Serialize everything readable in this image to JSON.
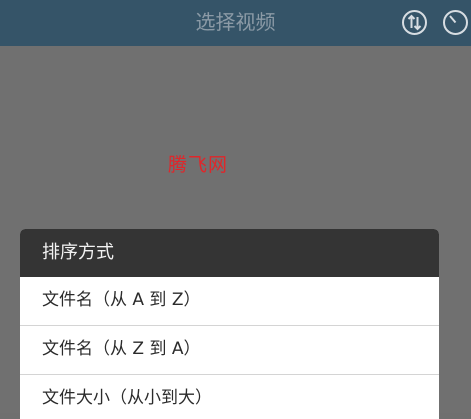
{
  "header": {
    "title": "选择视频",
    "sort_icon": "sort-arrows-icon",
    "timer_icon": "clock-icon"
  },
  "watermark": {
    "text": "腾飞网"
  },
  "sort_dialog": {
    "title": "排序方式",
    "options": [
      {
        "label": "文件名（从 A 到 Z）"
      },
      {
        "label": "文件名（从 Z 到 A）"
      },
      {
        "label": "文件大小（从小到大）"
      }
    ]
  },
  "colors": {
    "header_bg": "#355468",
    "overlay_bg": "#707070",
    "dialog_title_bg": "#343434",
    "watermark": "#e0262a"
  }
}
